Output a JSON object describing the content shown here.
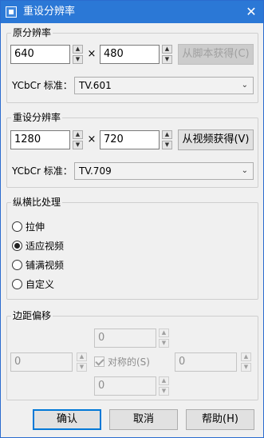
{
  "window": {
    "title": "重设分辨率",
    "close_glyph": "✕",
    "app_icon": "app-icon"
  },
  "original": {
    "group_label": "原分辨率",
    "width": "640",
    "height": "480",
    "times": "×",
    "from_script_button": "从脚本获得(C)",
    "ycbcr_label": "YCbCr 标准：",
    "ycbcr_value": "TV.601"
  },
  "resize": {
    "group_label": "重设分辨率",
    "width": "1280",
    "height": "720",
    "times": "×",
    "from_video_button": "从视频获得(V)",
    "ycbcr_label": "YCbCr 标准：",
    "ycbcr_value": "TV.709"
  },
  "aspect": {
    "group_label": "纵横比处理",
    "options": [
      {
        "label": "拉伸",
        "checked": false
      },
      {
        "label": "适应视频",
        "checked": true
      },
      {
        "label": "铺满视频",
        "checked": false
      },
      {
        "label": "自定义",
        "checked": false
      }
    ]
  },
  "margin": {
    "group_label": "边距偏移",
    "top": "0",
    "left": "0",
    "right": "0",
    "bottom": "0",
    "symmetric_label": "对称的(S)",
    "symmetric_checked": true
  },
  "footer": {
    "ok": "确认",
    "cancel": "取消",
    "help": "帮助(H)"
  },
  "glyphs": {
    "up": "▲",
    "down": "▼",
    "dropdown": "⌄"
  },
  "colors": {
    "titlebar": "#2b78d6",
    "accent": "#0078d7"
  }
}
